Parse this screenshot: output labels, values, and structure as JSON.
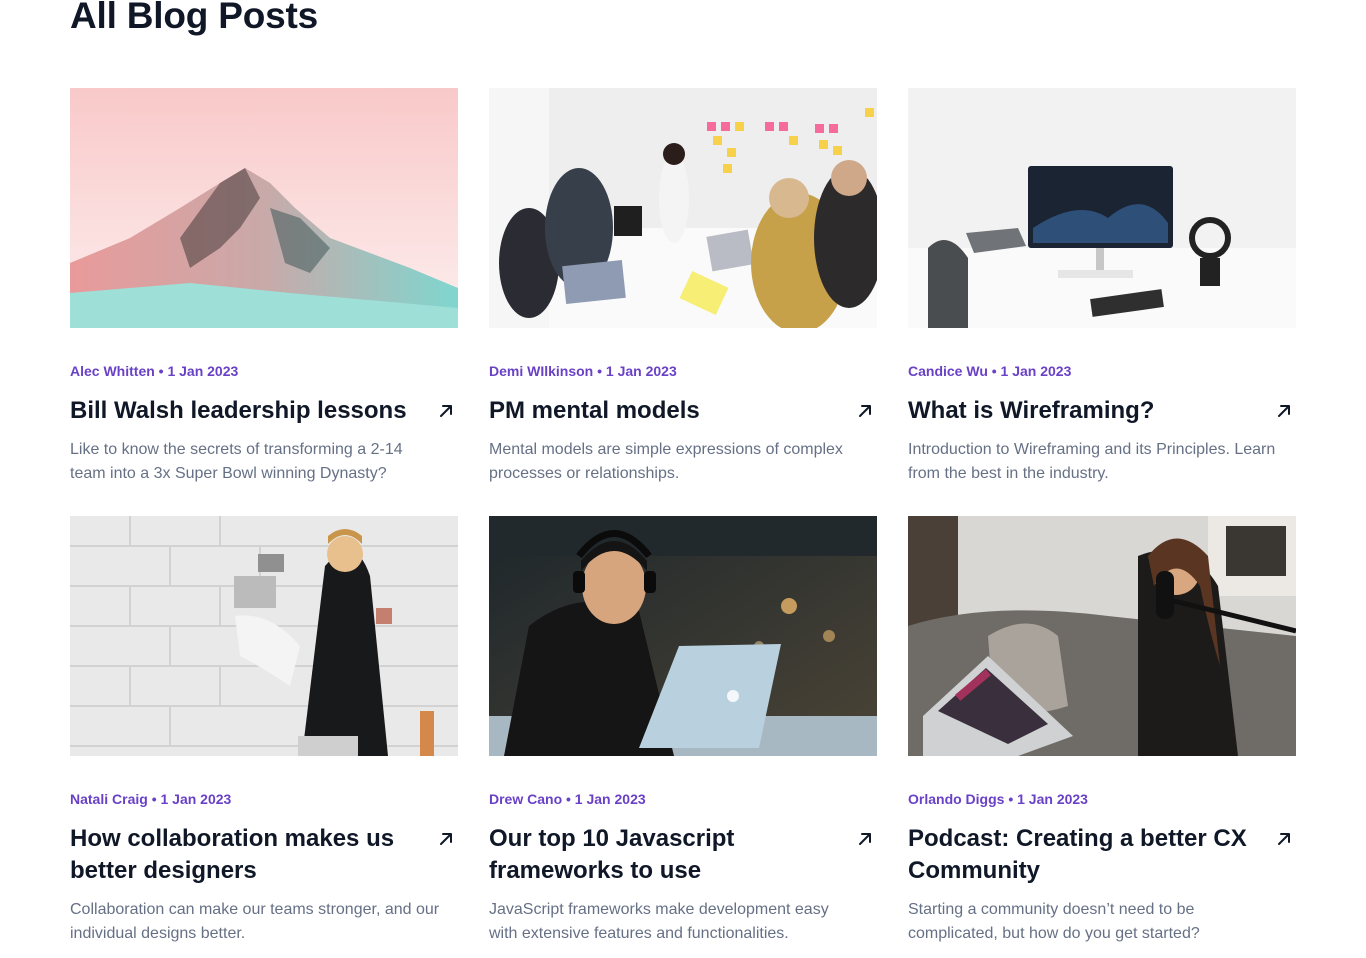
{
  "page": {
    "title": "All Blog Posts"
  },
  "colors": {
    "accent": "#6941c6",
    "heading": "#101828",
    "body": "#667085"
  },
  "posts": [
    {
      "author": "Alec Whitten",
      "date": "1 Jan 2023",
      "meta": "Alec Whitten • 1 Jan 2023",
      "title": "Bill Walsh leadership lessons",
      "excerpt": "Like to know the secrets of transforming a 2-14 team into a 3x Super Bowl winning Dynasty?",
      "icon": "arrow-up-right-icon"
    },
    {
      "author": "Demi WIlkinson",
      "date": "1 Jan 2023",
      "meta": "Demi WIlkinson • 1 Jan 2023",
      "title": "PM mental models",
      "excerpt": "Mental models are simple expressions of complex processes or relationships.",
      "icon": "arrow-up-right-icon"
    },
    {
      "author": "Candice Wu",
      "date": "1 Jan 2023",
      "meta": "Candice Wu • 1 Jan 2023",
      "title": "What is Wireframing?",
      "excerpt": "Introduction to Wireframing and its Principles. Learn from the best in the industry.",
      "icon": "arrow-up-right-icon"
    },
    {
      "author": "Natali Craig",
      "date": "1 Jan 2023",
      "meta": "Natali Craig • 1 Jan 2023",
      "title": "How collaboration makes us better designers",
      "excerpt": "Collaboration can make our teams stronger, and our individual designs better.",
      "icon": "arrow-up-right-icon"
    },
    {
      "author": "Drew Cano",
      "date": "1 Jan 2023",
      "meta": "Drew Cano • 1 Jan 2023",
      "title": "Our top 10 Javascript frameworks to use",
      "excerpt": "JavaScript frameworks make development easy with extensive features and functionalities.",
      "icon": "arrow-up-right-icon"
    },
    {
      "author": "Orlando Diggs",
      "date": "1 Jan 2023",
      "meta": "Orlando Diggs • 1 Jan 2023",
      "title": "Podcast: Creating a better CX Community",
      "excerpt": "Starting a community doesn’t need to be complicated, but how do you get started?",
      "icon": "arrow-up-right-icon"
    }
  ]
}
